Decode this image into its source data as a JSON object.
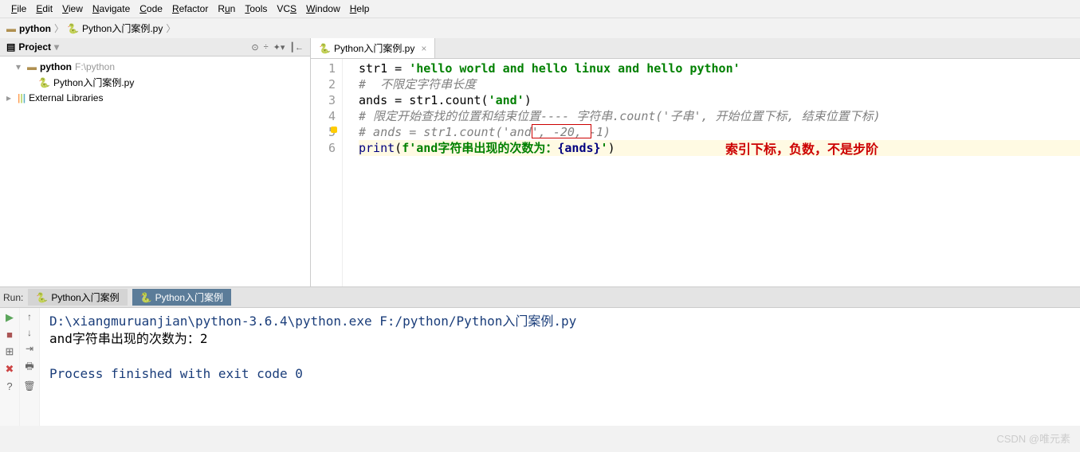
{
  "menu": [
    "File",
    "Edit",
    "View",
    "Navigate",
    "Code",
    "Refactor",
    "Run",
    "Tools",
    "VCS",
    "Window",
    "Help"
  ],
  "breadcrumb": {
    "folder": "python",
    "file": "Python入门案例.py"
  },
  "project": {
    "title": "Project",
    "root": "python",
    "root_path": "F:\\python",
    "file": "Python入门案例.py",
    "libs": "External Libraries"
  },
  "editor": {
    "tab": "Python入门案例.py",
    "annotation": "索引下标，负数，不是步阶",
    "lines": {
      "l1_a": "str1 ",
      "l1_b": "= ",
      "l1_c": "'hello world and hello linux and hello python'",
      "l2": "#  不限定字符串长度",
      "l3_a": "ands = str1.count(",
      "l3_b": "'and'",
      "l3_c": ")",
      "l4": "# 限定开始查找的位置和结束位置---- 字符串.count('子串', 开始位置下标, 结束位置下标)",
      "l5": "# ands = str1.count('and', -20, -1)",
      "l6_a": "print",
      "l6_b": "(",
      "l6_c": "f'and",
      "l6_d": "字符串出现的次数为：",
      "l6_e": "{ands}",
      "l6_f": "'",
      "l6_g": ")"
    }
  },
  "run": {
    "label": "Run:",
    "tab1": "Python入门案例",
    "tab2": "Python入门案例",
    "cmd": "D:\\xiangmuruanjian\\python-3.6.4\\python.exe F:/python/Python入门案例.py",
    "out1": "and字符串出现的次数为：2",
    "out2": "Process finished with exit code 0"
  },
  "watermark": "CSDN @唯元素"
}
